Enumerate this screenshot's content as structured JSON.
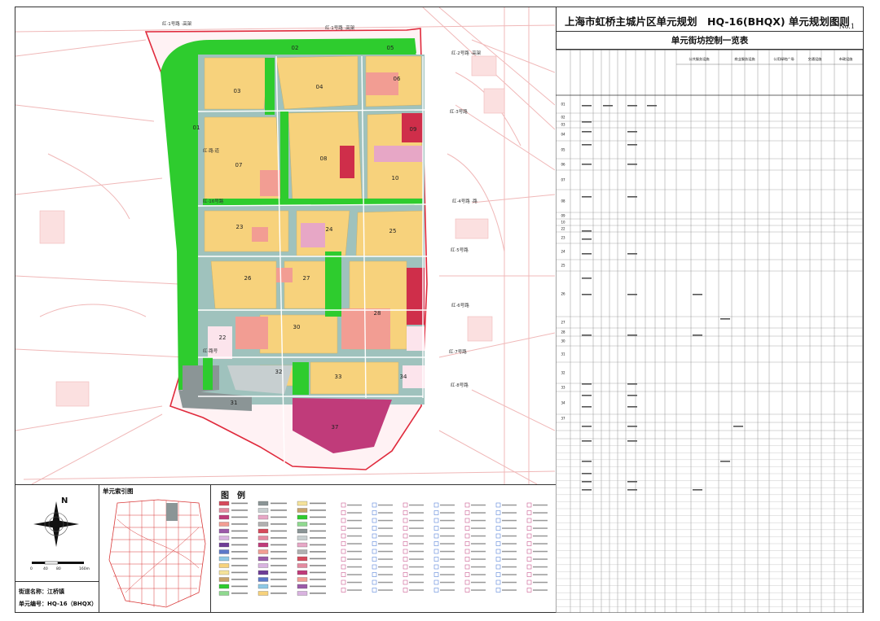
{
  "title": "上海市虹桥主城片区单元规划　HQ-16(BHQX) 单元规划图则",
  "sheet_no": "No.1",
  "table_title": "单元街坊控制一览表",
  "street_name": "街道名称：江桥镇",
  "unit_code": "单元编号：HQ-16（BHQX）",
  "index_map_label": "单元索引图",
  "legend_title": "图　例",
  "compass_label": "N",
  "scale_labels": [
    "0",
    "40",
    "80",
    "160m"
  ],
  "block_labels": [
    "01",
    "02",
    "03",
    "04",
    "05",
    "06",
    "07",
    "08",
    "09",
    "10",
    "22",
    "23",
    "24",
    "25",
    "26",
    "27",
    "28",
    "30",
    "31",
    "32",
    "33",
    "34",
    "37"
  ],
  "table_col_groups": [
    "公共服务设施",
    "商业服务设施",
    "公用绿地广场",
    "交通设施",
    "市政设施"
  ],
  "table_row_codes": [
    "01",
    "02",
    "03",
    "04",
    "05",
    "06",
    "07",
    "08",
    "09",
    "10",
    "22",
    "23",
    "24",
    "25",
    "26",
    "27",
    "28",
    "30",
    "31",
    "32",
    "33",
    "34",
    "37"
  ],
  "colors": {
    "residential": "#f7d27c",
    "green": "#2ecc2e",
    "road_teal": "#9fc2bd",
    "commercial": "#f29d93",
    "public_pink": "#e7a7c6",
    "magenta": "#c03b7a",
    "red": "#cf2e4a",
    "gray_block": "#8b9596",
    "light_gray": "#c7cfd0"
  }
}
